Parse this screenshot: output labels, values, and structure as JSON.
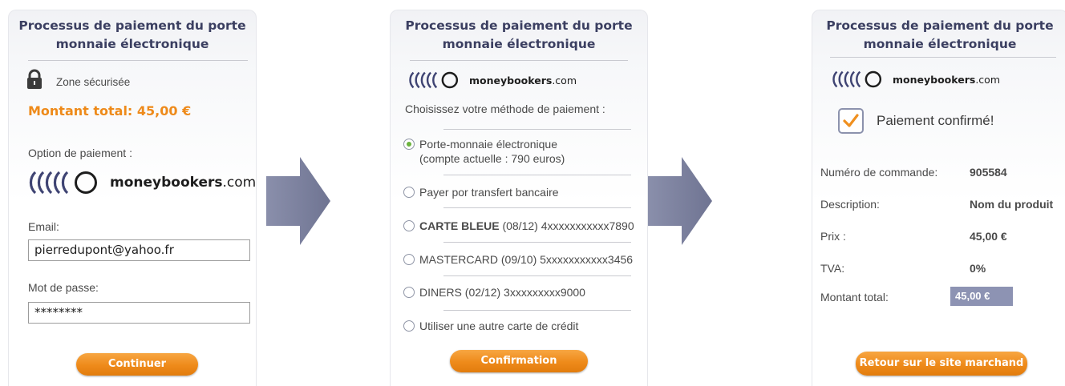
{
  "panel_title": "Processus de paiement du porte monnaie électronique",
  "logo": {
    "brand_bold": "moneybookers",
    "brand_suffix": ".com"
  },
  "step1": {
    "secure_zone": "Zone sécurisée",
    "total_label": "Montant total:",
    "total_value": "45,00 €",
    "option_label": "Option de paiement :",
    "email_label": "Email:",
    "email_value": "pierredupont@yahoo.fr",
    "password_label": "Mot de passe:",
    "password_value": "********",
    "continue_button": "Continuer"
  },
  "step2": {
    "choose_label": "Choisissez votre méthode de paiement :",
    "options": [
      {
        "line1": "Porte-monnaie électronique",
        "line2": "(compte actuelle : 790 euros)",
        "selected": true
      },
      {
        "text": "Payer por transfert bancaire",
        "selected": false
      },
      {
        "bold": "CARTE BLEUE",
        "text": " (08/12) 4xxxxxxxxxxx7890",
        "selected": false
      },
      {
        "text": "MASTERCARD (09/10) 5xxxxxxxxxxx3456",
        "selected": false
      },
      {
        "text": "DINERS (02/12) 3xxxxxxxxx9000",
        "selected": false
      },
      {
        "text": "Utiliser une autre carte de crédit",
        "selected": false
      }
    ],
    "confirm_button": "Confirmation"
  },
  "step3": {
    "confirmed": "Paiement confirmé!",
    "rows": [
      {
        "label": "Numéro de commande:",
        "value": "905584"
      },
      {
        "label": "Description:",
        "value": "Nom du produit"
      },
      {
        "label": "Prix :",
        "value": "45,00 €"
      },
      {
        "label": "TVA:",
        "value": "0%"
      }
    ],
    "total_label": "Montant total:",
    "total_value": "45,00 €",
    "return_button": "Retour sur le site marchand"
  },
  "icons": {
    "lock": "padlock-icon",
    "check": "checkbox-checked-icon",
    "arrow": "right-arrow-icon",
    "logo": "moneybookers-rings-icon"
  },
  "colors": {
    "accent_orange": "#ee8a1a",
    "title_navy": "#3b3f61",
    "arrow_slate": "#7b809c",
    "badge": "#8d93b3",
    "radio_on": "#6cb33e"
  }
}
